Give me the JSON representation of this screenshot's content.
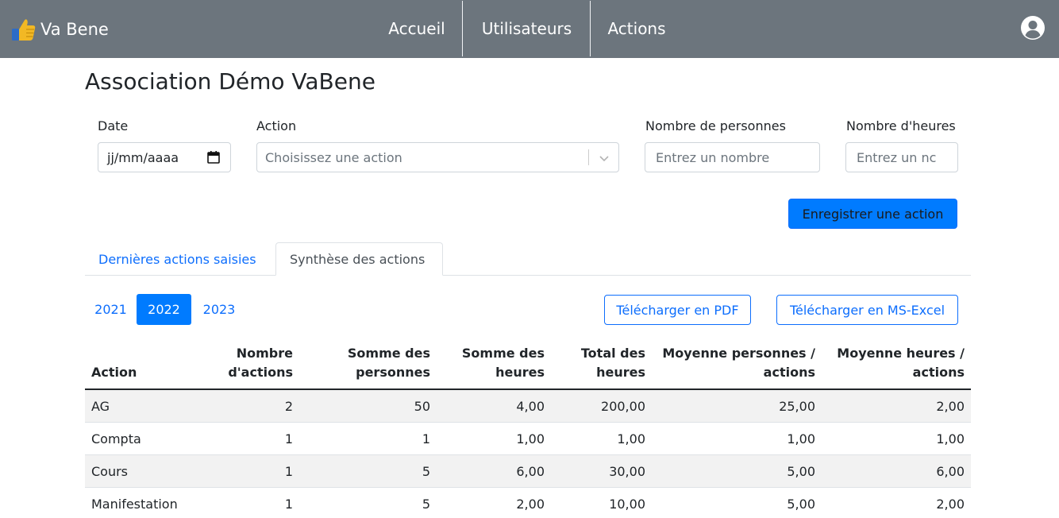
{
  "navbar": {
    "brand": "Va Bene",
    "links": [
      "Accueil",
      "Utilisateurs",
      "Actions"
    ]
  },
  "page": {
    "title": "Association Démo VaBene"
  },
  "form": {
    "date_label": "Date",
    "date_value": "jj/mm/aaaa",
    "action_label": "Action",
    "action_placeholder": "Choisissez une action",
    "persons_label": "Nombre de personnes",
    "persons_placeholder": "Entrez un nombre",
    "hours_label": "Nombre d'heures",
    "hours_placeholder": "Entrez un nc",
    "submit_label": "Enregistrer une action"
  },
  "tabs": {
    "recent": "Dernières actions saisies",
    "summary": "Synthèse des actions"
  },
  "years": {
    "items": [
      "2021",
      "2022",
      "2023"
    ],
    "selected": "2022"
  },
  "downloads": {
    "pdf": "Télécharger en PDF",
    "excel": "Télécharger en MS-Excel"
  },
  "table": {
    "headers": [
      [
        "Action"
      ],
      [
        "Nombre",
        "d'actions"
      ],
      [
        "Somme des",
        "personnes"
      ],
      [
        "Somme des",
        "heures"
      ],
      [
        "Total des",
        "heures"
      ],
      [
        "Moyenne personnes /",
        "actions"
      ],
      [
        "Moyenne heures /",
        "actions"
      ]
    ],
    "rows": [
      [
        "AG",
        "2",
        "50",
        "4,00",
        "200,00",
        "25,00",
        "2,00"
      ],
      [
        "Compta",
        "1",
        "1",
        "1,00",
        "1,00",
        "1,00",
        "1,00"
      ],
      [
        "Cours",
        "1",
        "5",
        "6,00",
        "30,00",
        "5,00",
        "6,00"
      ],
      [
        "Manifestation",
        "1",
        "5",
        "2,00",
        "10,00",
        "5,00",
        "2,00"
      ]
    ]
  },
  "colors": {
    "navbar": "#6c757d",
    "primary": "#007bff",
    "link": "#0d6efd"
  }
}
